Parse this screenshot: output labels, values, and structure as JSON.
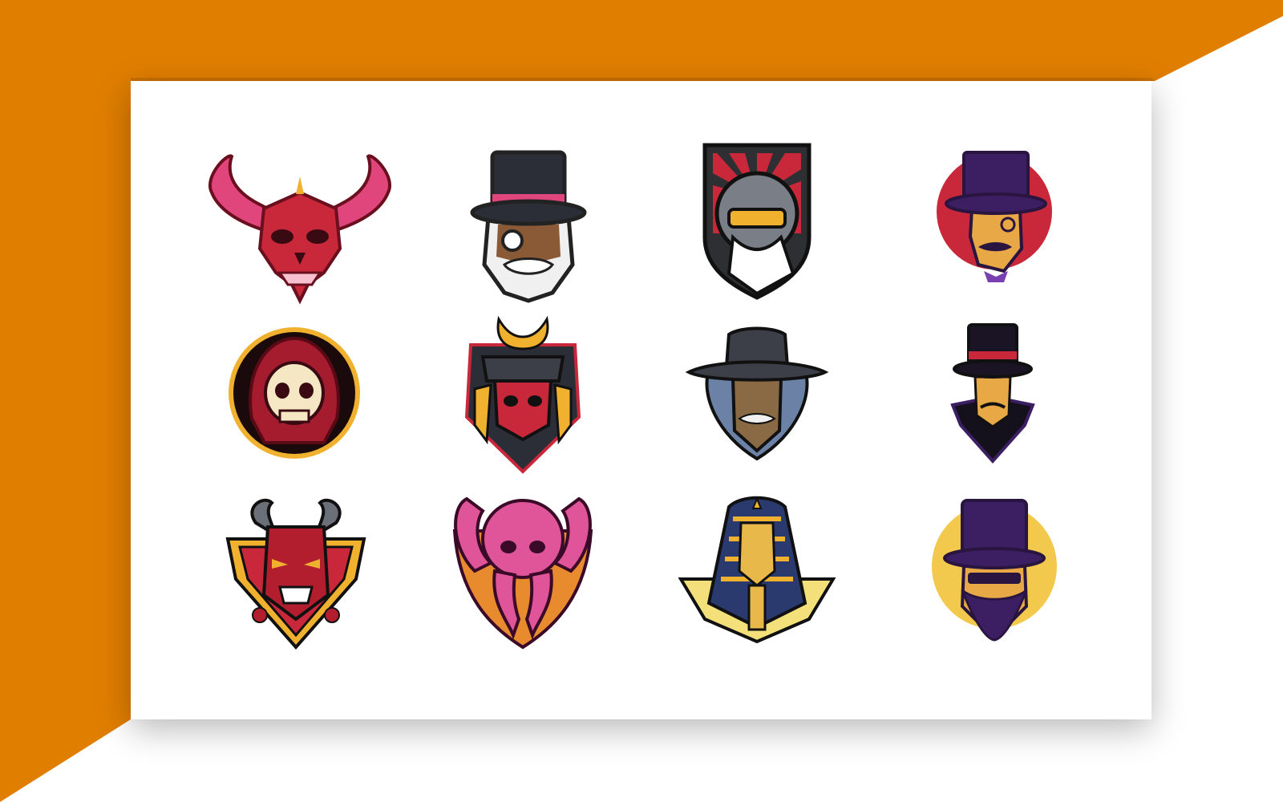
{
  "colors": {
    "frame_orange": "#E07E00",
    "frame_shadow": "#B86500",
    "card": "#FFFFFF",
    "outline": "#111111",
    "red": "#C9283B",
    "pink": "#E0457C",
    "purple": "#3C1F63",
    "gold": "#F0B12E",
    "skin": "#E8A845",
    "gray": "#5B5F68"
  },
  "logos": [
    {
      "name": "demon-skull-horns-logo",
      "icon": "demon-skull-horns-icon"
    },
    {
      "name": "top-hat-monocle-gentleman-logo",
      "icon": "top-hat-old-man-icon"
    },
    {
      "name": "pilot-helmet-goggles-logo",
      "icon": "pilot-helmet-icon"
    },
    {
      "name": "top-hat-gentleman-red-circle-logo",
      "icon": "top-hat-gentleman-icon"
    },
    {
      "name": "hooded-skull-reaper-logo",
      "icon": "hooded-skull-icon"
    },
    {
      "name": "samurai-skull-helmet-logo",
      "icon": "samurai-helmet-icon"
    },
    {
      "name": "cowboy-hat-man-logo",
      "icon": "cowboy-hat-icon"
    },
    {
      "name": "top-hat-cape-gentleman-logo",
      "icon": "top-hat-cape-icon"
    },
    {
      "name": "oni-demon-mask-logo",
      "icon": "oni-mask-icon"
    },
    {
      "name": "octopus-kraken-logo",
      "icon": "octopus-icon"
    },
    {
      "name": "pharaoh-sphinx-logo",
      "icon": "pharaoh-icon"
    },
    {
      "name": "top-hat-bearded-man-yellow-circle-logo",
      "icon": "top-hat-beard-icon"
    }
  ]
}
